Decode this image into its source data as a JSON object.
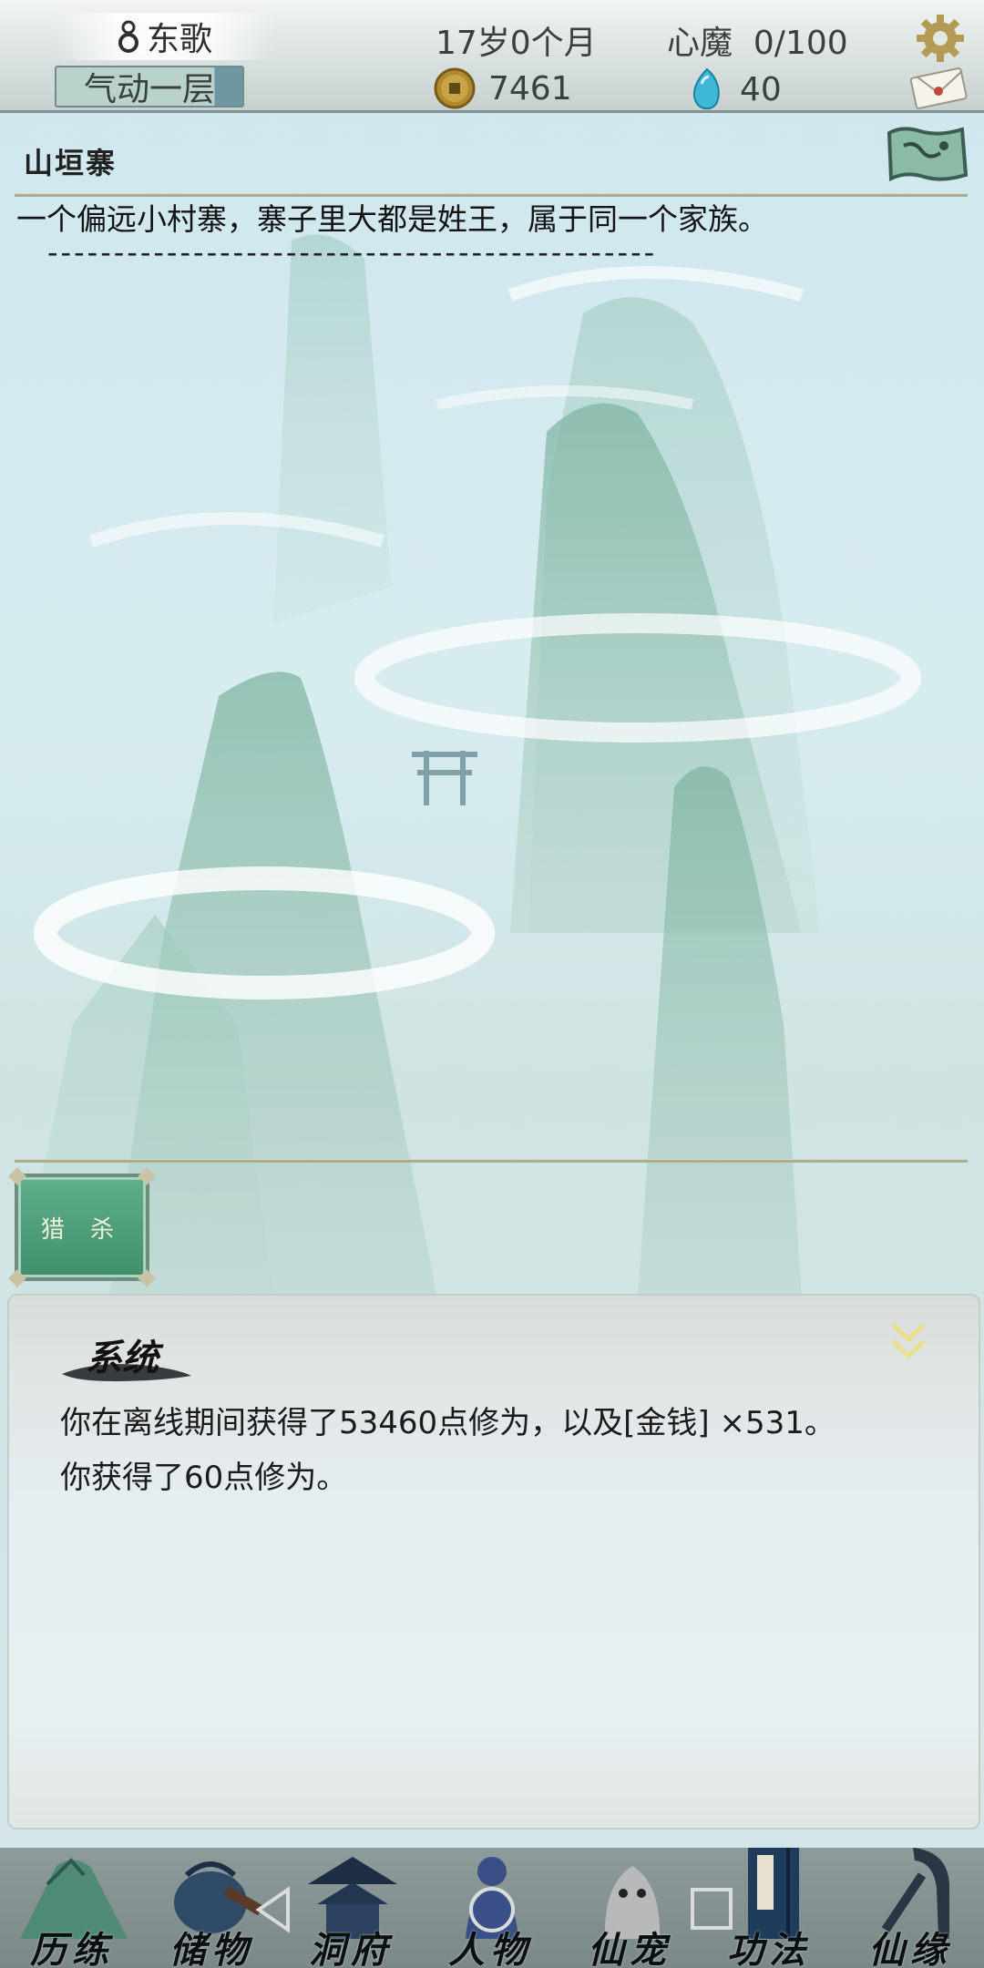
{
  "player": {
    "name": "东歌",
    "realm": "气动一层",
    "age": "17岁0个月",
    "demon_label": "心魔",
    "demon_value": "0/100",
    "coins": "7461",
    "gems": "40",
    "realm_progress": 0.85
  },
  "location": {
    "title": "山垣寨",
    "description": "一个偏远小村寨，寨子里大都是姓王，属于同一个家族。",
    "divider": "----------------------------------------------"
  },
  "actions": {
    "hunt_label": "猎 杀"
  },
  "log": {
    "title": "系统",
    "lines": [
      "你在离线期间获得了53460点修为，以及[金钱] ×531。",
      "你获得了60点修为。"
    ]
  },
  "nav": {
    "items": [
      {
        "label": "历练",
        "icon": "mountain-icon"
      },
      {
        "label": "储物",
        "icon": "bag-icon"
      },
      {
        "label": "洞府",
        "icon": "pavilion-icon"
      },
      {
        "label": "人物",
        "icon": "person-icon"
      },
      {
        "label": "仙宠",
        "icon": "pet-icon"
      },
      {
        "label": "功法",
        "icon": "scroll-icon"
      },
      {
        "label": "仙缘",
        "icon": "crane-icon"
      }
    ]
  },
  "colors": {
    "accent_green": "#3f8f6d",
    "topbar": "#dbe3e1",
    "nav": "#8e9b9b",
    "gold": "#e8e08a"
  }
}
